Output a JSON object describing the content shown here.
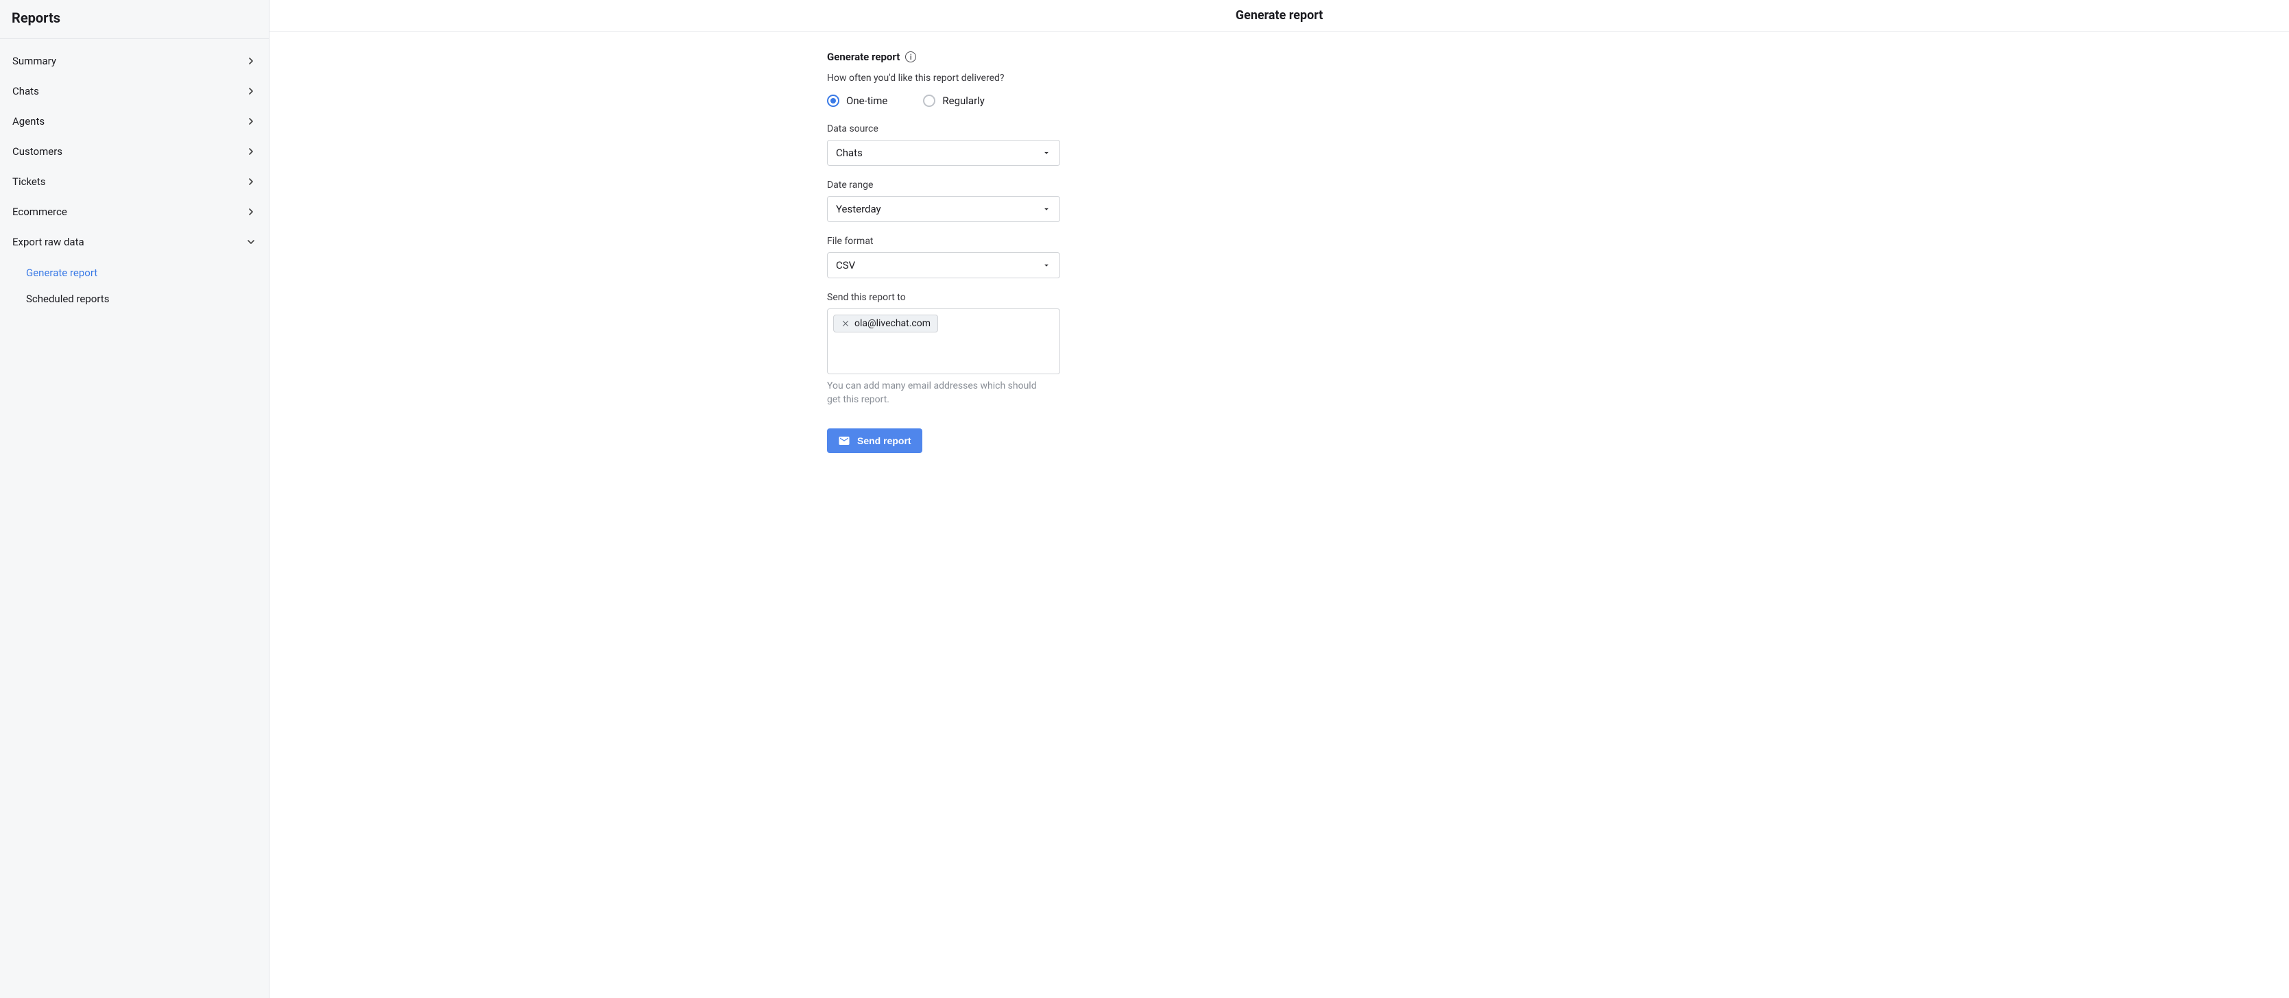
{
  "sidebar": {
    "title": "Reports",
    "items": [
      {
        "label": "Summary",
        "expanded": false
      },
      {
        "label": "Chats",
        "expanded": false
      },
      {
        "label": "Agents",
        "expanded": false
      },
      {
        "label": "Customers",
        "expanded": false
      },
      {
        "label": "Tickets",
        "expanded": false
      },
      {
        "label": "Ecommerce",
        "expanded": false
      }
    ],
    "export": {
      "label": "Export raw data",
      "expanded": true,
      "children": [
        {
          "label": "Generate report",
          "active": true
        },
        {
          "label": "Scheduled reports",
          "active": false
        }
      ]
    }
  },
  "header": {
    "title": "Generate report"
  },
  "form": {
    "section_label": "Generate report",
    "question": "How often you'd like this report delivered?",
    "frequency": {
      "one_time_label": "One-time",
      "regularly_label": "Regularly",
      "selected": "one_time"
    },
    "data_source": {
      "label": "Data source",
      "value": "Chats"
    },
    "date_range": {
      "label": "Date range",
      "value": "Yesterday"
    },
    "file_format": {
      "label": "File format",
      "value": "CSV"
    },
    "recipients": {
      "label": "Send this report to",
      "tokens": [
        "ola@livechat.com"
      ],
      "hint": "You can add many email addresses which should get this report."
    },
    "send_button_label": "Send report"
  }
}
